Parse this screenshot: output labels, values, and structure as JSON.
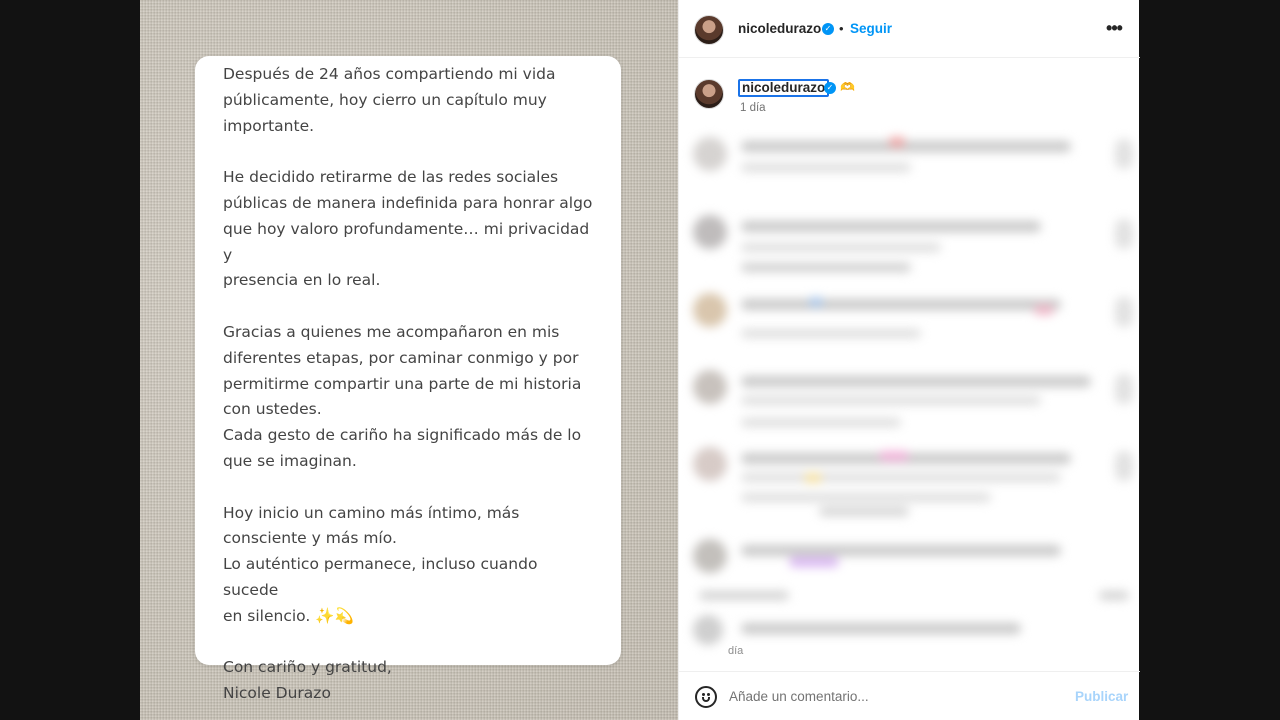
{
  "post": {
    "username": "nicoledurazo",
    "verified_mark": "✓",
    "separator": "•",
    "follow_label": "Seguir",
    "more_label": "•••"
  },
  "caption": {
    "username": "nicoledurazo",
    "verified_mark": "✓",
    "emoji": "🫶",
    "time": "1 día"
  },
  "note": {
    "paragraphs": [
      "Después de 24 años compartiendo mi vida\npúblicamente, hoy cierro un capítulo muy\nimportante.",
      "He decidido retirarme de las redes sociales\npúblicas de manera indefinida para honrar algo\nque hoy valoro profundamente… mi privacidad y\npresencia en lo real.",
      "Gracias a quienes me acompañaron en mis\ndiferentes etapas, por caminar conmigo y por\npermitirme compartir una parte de mi historia\ncon ustedes.\nCada gesto de cariño ha significado más de lo\nque se imaginan.",
      "Hoy inicio un camino más íntimo, más\nconsciente y más mío.\nLo auténtico permanece, incluso cuando sucede\nen silencio. ✨💫",
      "Con cariño y gratitud,\nNicole Durazo"
    ]
  },
  "comments_residual": {
    "time": "día"
  },
  "add_comment": {
    "placeholder": "Añade un comentario...",
    "publish_label": "Publicar"
  },
  "colors": {
    "accent": "#0095f6",
    "publish_disabled": "#a8d4fb",
    "note_text": "#444444",
    "linen": "#cfc8bb"
  },
  "icons": {
    "emoji_button": "smiley-icon",
    "verified": "verified-badge-icon",
    "more": "more-options-icon"
  }
}
